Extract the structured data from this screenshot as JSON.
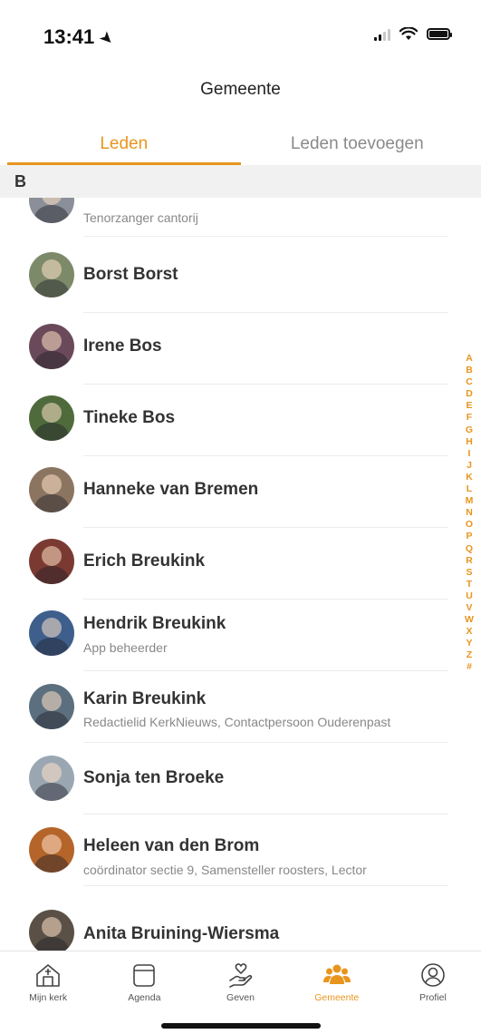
{
  "status_bar": {
    "time": "13:41"
  },
  "header": {
    "title": "Gemeente"
  },
  "tabs": [
    {
      "label": "Leden",
      "active": true
    },
    {
      "label": "Leden toevoegen",
      "active": false
    }
  ],
  "section": {
    "letter": "B"
  },
  "members": [
    {
      "name": "",
      "subtitle": "Tenorzanger cantorij",
      "avatar_color": "#8a8f99"
    },
    {
      "name": "Borst Borst",
      "subtitle": "",
      "avatar_color": "#7d8a6a"
    },
    {
      "name": "Irene Bos",
      "subtitle": "",
      "avatar_color": "#6a4a5a"
    },
    {
      "name": "Tineke Bos",
      "subtitle": "",
      "avatar_color": "#4f6b3c"
    },
    {
      "name": "Hanneke van Bremen",
      "subtitle": "",
      "avatar_color": "#8c7560"
    },
    {
      "name": "Erich Breukink",
      "subtitle": "",
      "avatar_color": "#7a3a32"
    },
    {
      "name": "Hendrik Breukink",
      "subtitle": "App beheerder",
      "avatar_color": "#3e5f8c"
    },
    {
      "name": "Karin Breukink",
      "subtitle": "Redactielid KerkNieuws, Contactpersoon Ouderenpast",
      "avatar_color": "#5b6f7e"
    },
    {
      "name": "Sonja ten Broeke",
      "subtitle": "",
      "avatar_color": "#9aa7b3"
    },
    {
      "name": "Heleen van den Brom",
      "subtitle": "coördinator sectie 9, Samensteller roosters, Lector",
      "avatar_color": "#b5652a"
    },
    {
      "name": "Anita Bruining-Wiersma",
      "subtitle": "",
      "avatar_color": "#5a5046"
    }
  ],
  "alphabet": [
    "A",
    "B",
    "C",
    "D",
    "E",
    "F",
    "G",
    "H",
    "I",
    "J",
    "K",
    "L",
    "M",
    "N",
    "O",
    "P",
    "Q",
    "R",
    "S",
    "T",
    "U",
    "V",
    "W",
    "X",
    "Y",
    "Z",
    "#"
  ],
  "tab_bar": [
    {
      "label": "Mijn kerk",
      "icon": "church-icon",
      "active": false
    },
    {
      "label": "Agenda",
      "icon": "calendar-icon",
      "active": false
    },
    {
      "label": "Geven",
      "icon": "giving-hand-icon",
      "active": false
    },
    {
      "label": "Gemeente",
      "icon": "people-icon",
      "active": true
    },
    {
      "label": "Profiel",
      "icon": "profile-icon",
      "active": false
    }
  ],
  "colors": {
    "accent": "#e8951e",
    "section_bg": "#f1f1f1",
    "text": "#333333",
    "subtitle": "#888888"
  }
}
